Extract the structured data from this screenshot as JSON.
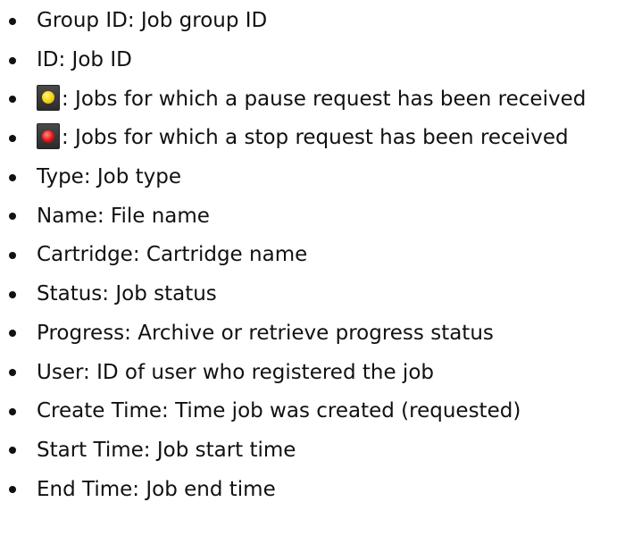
{
  "colors": {
    "pause_lamp": "#f6d100",
    "stop_lamp": "#e01010",
    "icon_frame": "#3a3a3a"
  },
  "items": [
    {
      "text": "Group ID: Job group ID"
    },
    {
      "text": "ID: Job ID"
    },
    {
      "icon": "pause-request-icon",
      "text": ": Jobs for which a pause request has been received"
    },
    {
      "icon": "stop-request-icon",
      "text": ": Jobs for which a stop request has been received"
    },
    {
      "text": "Type: Job type"
    },
    {
      "text": "Name: File name"
    },
    {
      "text": "Cartridge: Cartridge name"
    },
    {
      "text": "Status: Job status"
    },
    {
      "text": "Progress: Archive or retrieve progress status"
    },
    {
      "text": "User: ID of user who registered the job"
    },
    {
      "text": "Create Time: Time job was created (requested)"
    },
    {
      "text": "Start Time: Job start time"
    },
    {
      "text": "End Time: Job end time"
    }
  ]
}
